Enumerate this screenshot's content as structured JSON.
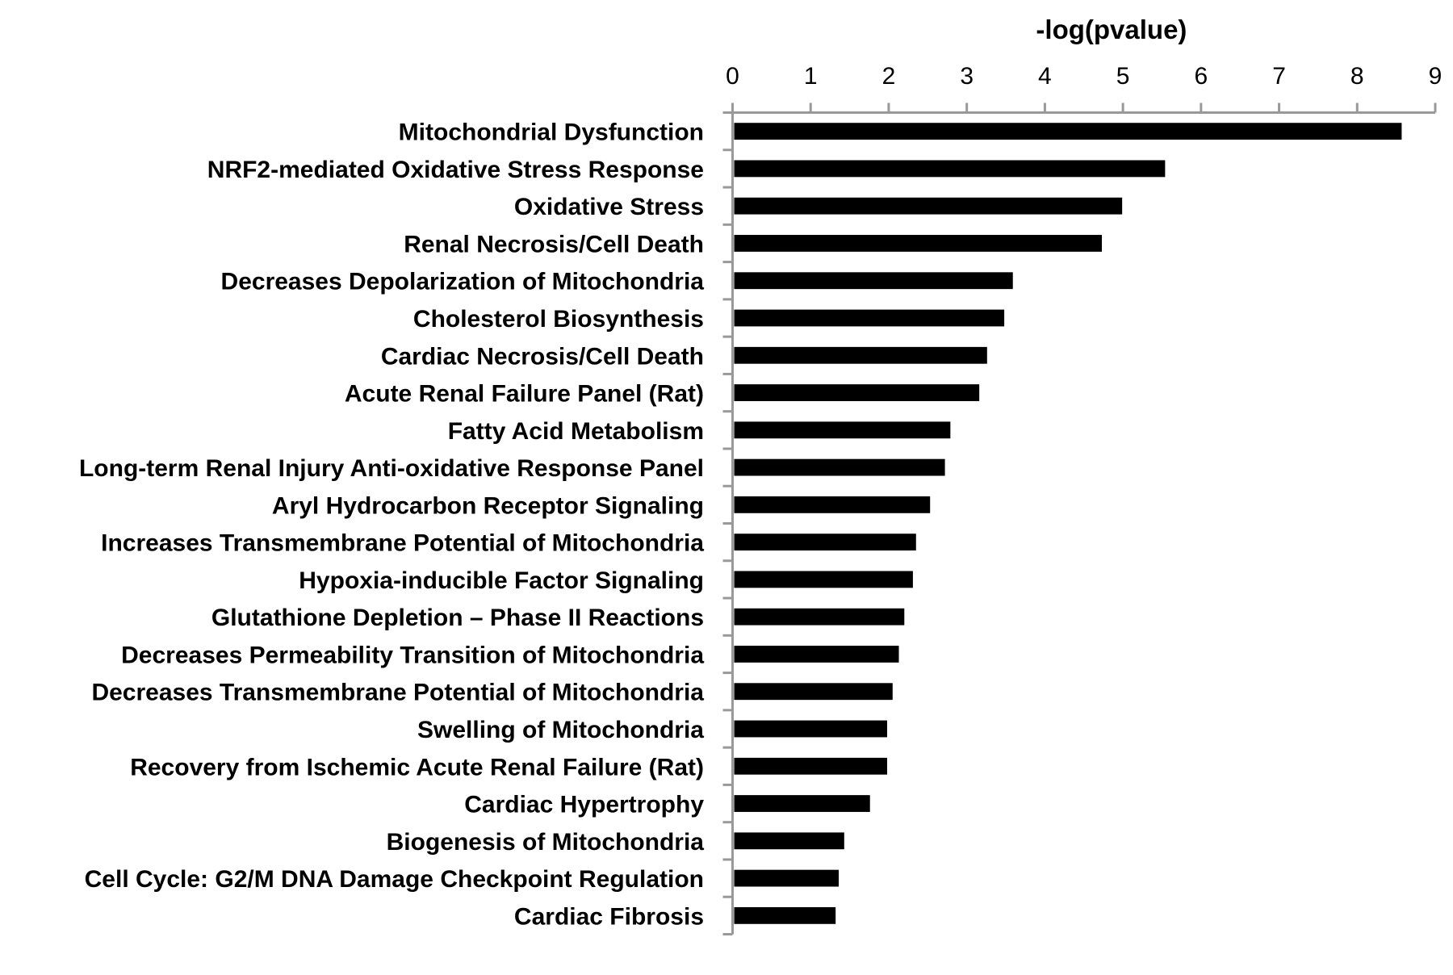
{
  "chart_data": {
    "type": "bar",
    "orientation": "horizontal",
    "title": "-log(pvalue)",
    "xlabel": "-log(pvalue)",
    "ylabel": "",
    "xlim": [
      0,
      9
    ],
    "x_ticks": [
      0,
      1,
      2,
      3,
      4,
      5,
      6,
      7,
      8,
      9
    ],
    "x_tick_labels": [
      "0",
      "1",
      "2",
      "3",
      "4",
      "5",
      "6",
      "7",
      "8",
      "9"
    ],
    "x_axis_position": "top",
    "grid": false,
    "legend": "none",
    "bar_color": "#000000",
    "axis_color": "#999999",
    "categories": [
      "Mitochondrial Dysfunction",
      "NRF2-mediated Oxidative Stress Response",
      "Oxidative Stress",
      "Renal Necrosis/Cell Death",
      "Decreases Depolarization of Mitochondria",
      "Cholesterol Biosynthesis",
      "Cardiac Necrosis/Cell Death",
      "Acute Renal Failure Panel (Rat)",
      "Fatty Acid Metabolism",
      "Long-term Renal Injury Anti-oxidative Response Panel",
      "Aryl Hydrocarbon Receptor Signaling",
      "Increases Transmembrane Potential of Mitochondria",
      "Hypoxia-inducible Factor Signaling",
      "Glutathione Depletion – Phase II Reactions",
      "Decreases Permeability Transition of Mitochondria",
      "Decreases Transmembrane Potential of Mitochondria",
      "Swelling of Mitochondria",
      "Recovery from Ischemic Acute Renal Failure (Rat)",
      "Cardiac Hypertrophy",
      "Biogenesis of Mitochondria",
      "Cell Cycle: G2/M DNA Damage Checkpoint Regulation",
      "Cardiac Fibrosis"
    ],
    "values": [
      8.57,
      5.54,
      4.99,
      4.73,
      3.59,
      3.48,
      3.26,
      3.16,
      2.79,
      2.72,
      2.53,
      2.35,
      2.31,
      2.2,
      2.13,
      2.05,
      1.98,
      1.98,
      1.76,
      1.43,
      1.36,
      1.32
    ]
  }
}
